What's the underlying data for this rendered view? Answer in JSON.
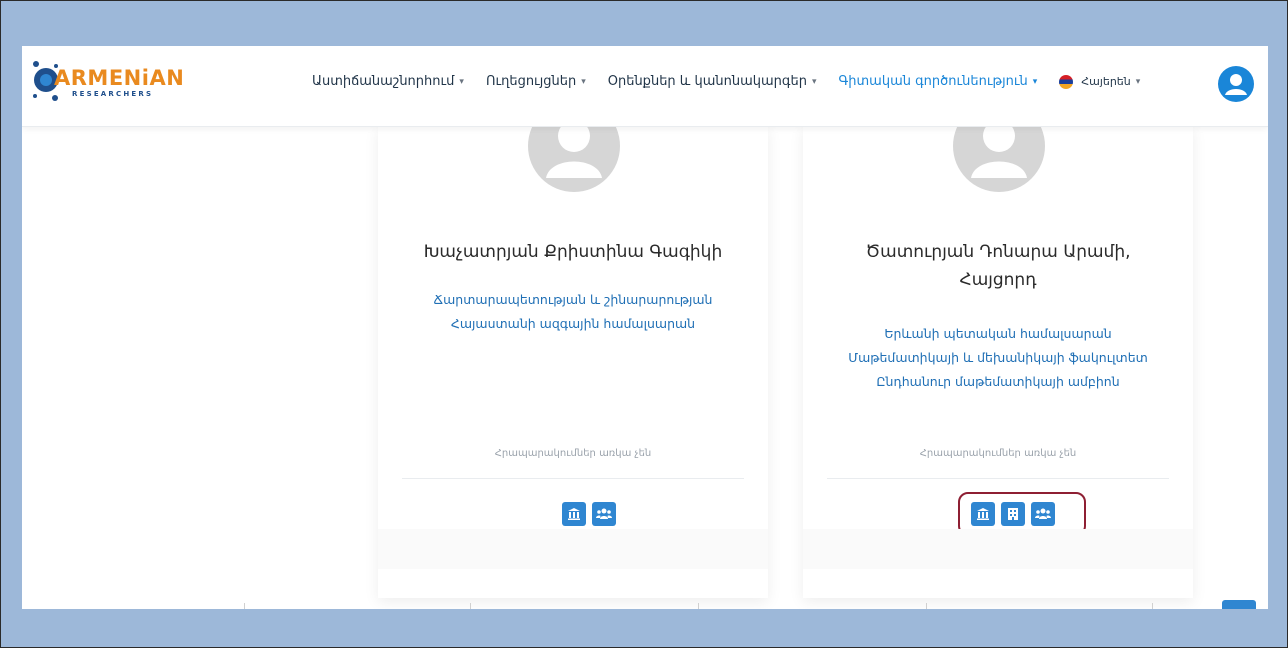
{
  "brand": {
    "name": "ARMENiAN",
    "sub": "RESEARCHERS",
    "accent": "#e98a1f",
    "sub_color": "#1f4f8c"
  },
  "nav": {
    "items": [
      {
        "label": "Աստիճանաշնորհում",
        "active": false
      },
      {
        "label": "Ուղեցույցներ",
        "active": false
      },
      {
        "label": "Օրենքներ և կանոնակարգեր",
        "active": false
      },
      {
        "label": "Գիտական գործունեություն",
        "active": true
      }
    ],
    "language": "Հայերեն",
    "active_color": "#1a86d8"
  },
  "cards": [
    {
      "name_lines": [
        "Խաչատրյան Քրիստինա Գագիկի"
      ],
      "affiliation_lines": [
        "Ճարտարապետության և շինարարության",
        "Հայաստանի ազգային համալսարան"
      ],
      "note": "Հրապարակումներ առկա չեն",
      "buttons": [
        "university-icon",
        "users-icon"
      ]
    },
    {
      "name_lines": [
        "Ծատուրյան Դոնարա Արամի,",
        "Հայցորդ"
      ],
      "affiliation_lines": [
        "Երևանի պետական համալսարան",
        "Մաթեմատիկայի և մեխանիկայի ֆակուլտետ",
        "Ընդհանուր մաթեմատիկայի ամբիոն"
      ],
      "note": "Հրապարակումներ առկա չեն",
      "buttons": [
        "university-icon",
        "building-icon",
        "users-icon"
      ]
    }
  ],
  "colors": {
    "button": "#2f86d1",
    "highlight": "#8e1f33",
    "frame_bg": "#9db8d9"
  }
}
